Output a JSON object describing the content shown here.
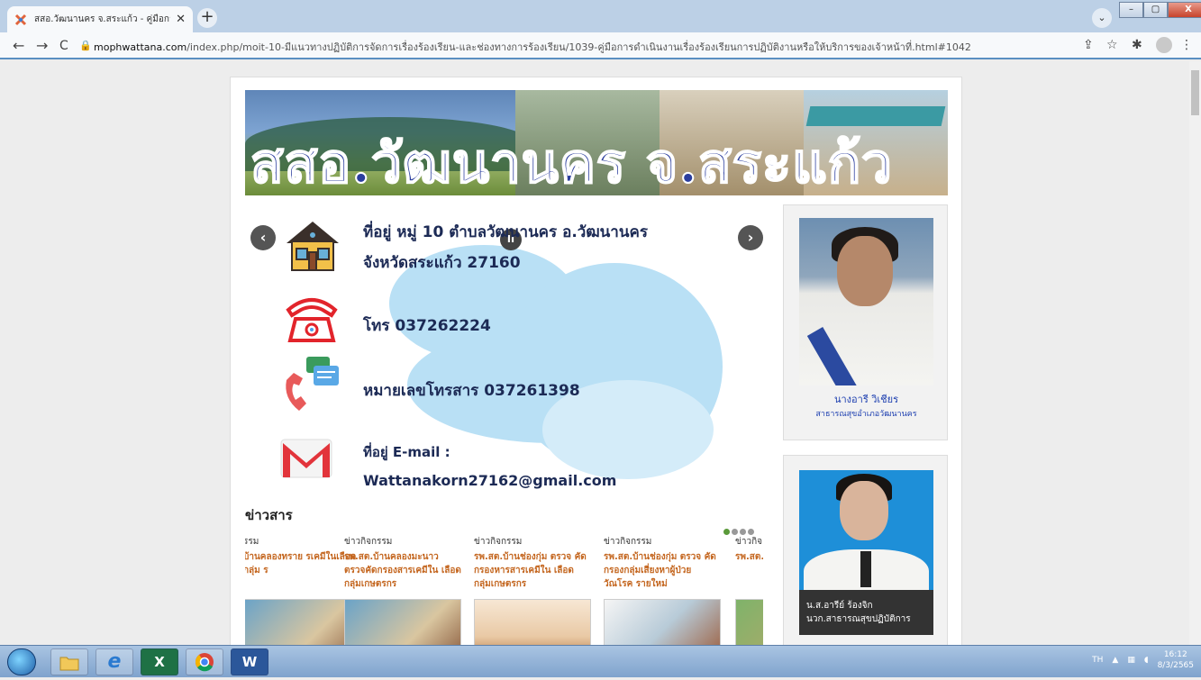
{
  "browser": {
    "tab_title": "สสอ.วัฒนานคร จ.สระแก้ว - คู่มือการ",
    "tab_close": "✕",
    "new_tab": "+",
    "tab_menu": "⌄",
    "url_host": "mophwattana.com",
    "url_path": "/index.php/moit-10-มีแนวทางปฏิบัติการจัดการเรื่องร้องเรียน-และช่องทางการร้องเรียน/1039-คู่มือการดำเนินงานเรื่องร้องเรียนการปฏิบัติงานหรือให้บริการของเจ้าหน้าที่.html#1042",
    "back": "←",
    "forward": "→",
    "reload": "C",
    "lock": "🔒",
    "share": "⇪",
    "star": "☆",
    "extensions": "✱",
    "more": "⋮",
    "win_min": "–",
    "win_max": "▢",
    "win_close": "X"
  },
  "banner": {
    "title": "สสอ.วัฒนานคร จ.สระแก้ว"
  },
  "slider": {
    "prev": "‹",
    "next": "›",
    "pause": "II",
    "address_line1": "ที่อยู่ หมู่ 10 ตำบลวัฒนานคร อ.วัฒนานคร",
    "address_line2": "จังหวัดสระแก้ว 27160",
    "phone": "โทร 037262224",
    "fax": "หมายเลขโทรสาร 037261398",
    "email_label": "ที่อยู่ E-mail :",
    "email": "Wattanakorn27162@gmail.com"
  },
  "news": {
    "heading": "ข่าวสาร",
    "items": [
      {
        "cat": "รรม",
        "title": "บ้านคลองทราย รเคมีในเลือดกลุ่ม ร"
      },
      {
        "cat": "ข่าวกิจกรรม",
        "title": "รพ.สต.บ้านคลองมะนาว ตรวจคัดกรองสารเคมีใน เลือด กลุ่มเกษตรกร"
      },
      {
        "cat": "ข่าวกิจกรรม",
        "title": "รพ.สต.บ้านช่องกุ่ม ตรวจ คัดกรองหารสารเคมีใน เลือด กลุ่มเกษตรกร"
      },
      {
        "cat": "ข่าวกิจกรรม",
        "title": "รพ.สต.บ้านช่องกุ่ม ตรวจ คัดกรองกลุ่มเสี่ยงหาผู้ป่วย วัณโรค รายใหม่"
      },
      {
        "cat": "ข่าวกิจ",
        "title": "รพ.สต. ตรวจคัด ผู้ป่วยวั"
      }
    ]
  },
  "sidebar": {
    "person1_name": "นางอารี วิเชียร",
    "person1_role": "สาธารณสุขอำเภอวัฒนานคร",
    "person2_name": "น.ส.อารีย์ ร้องจิก",
    "person2_role": "นวก.สาธารณสุขปฏิบัติการ"
  },
  "taskbar": {
    "lang": "TH",
    "time": "16:12",
    "date": "8/3/2565",
    "app_excel": "X",
    "app_word": "W",
    "app_ie": "e"
  }
}
